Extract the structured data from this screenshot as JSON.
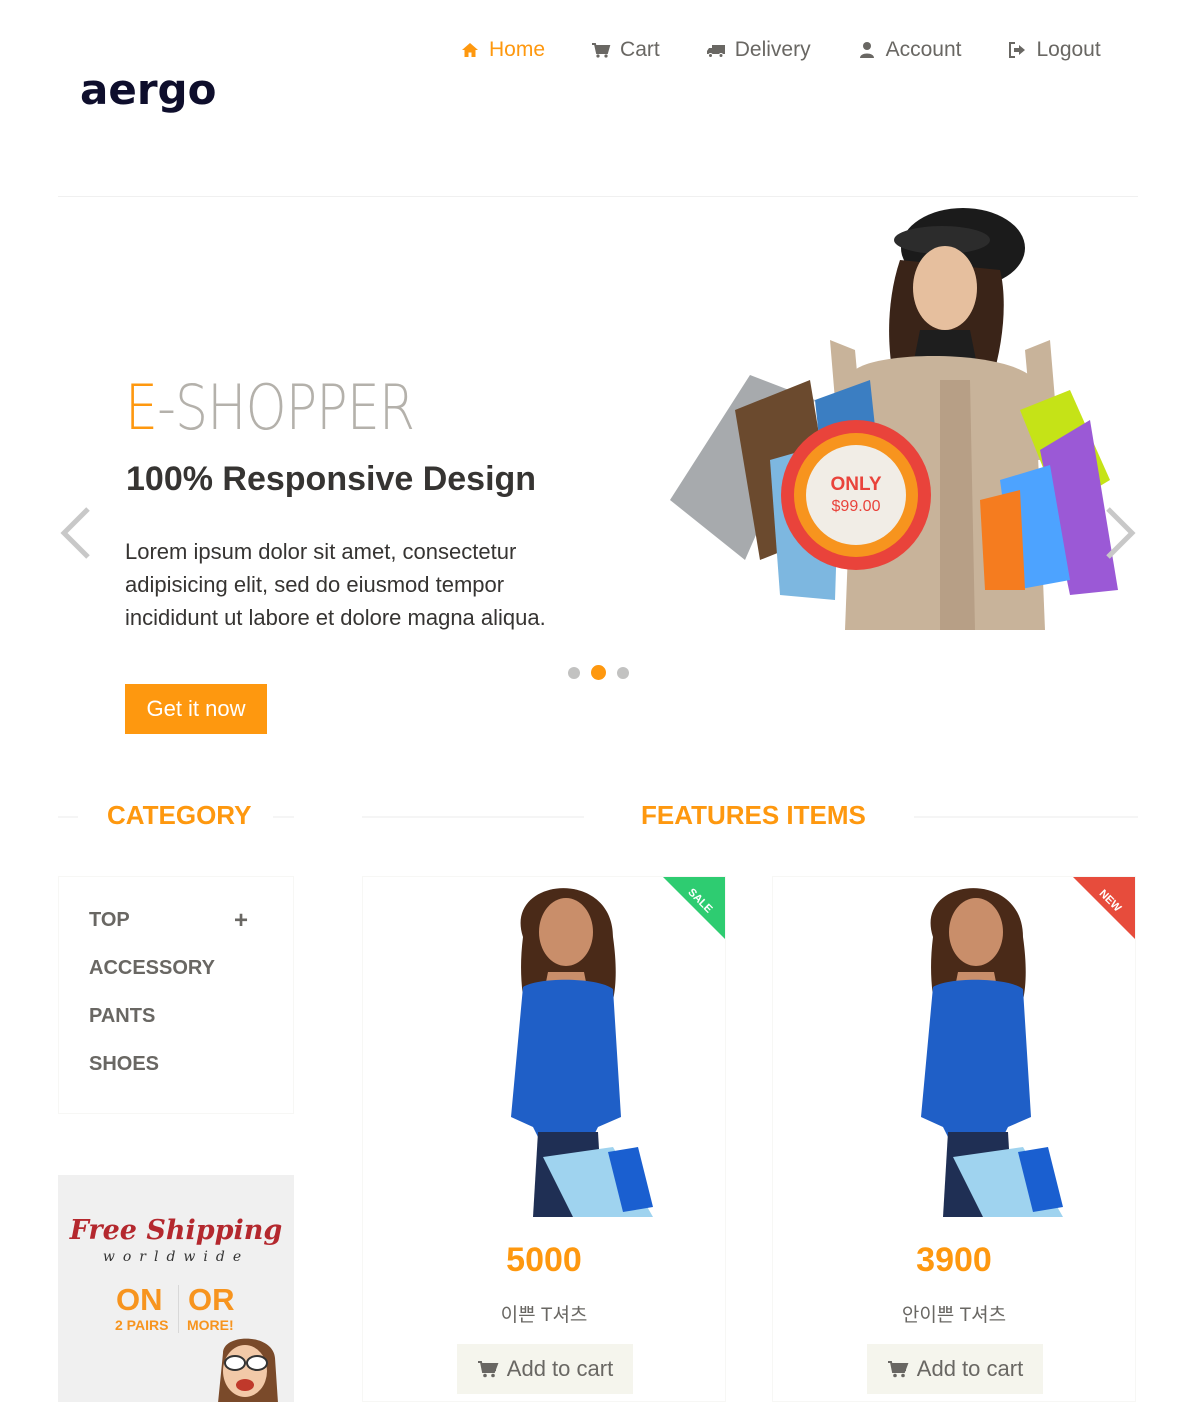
{
  "header": {
    "logo_text": "aergo",
    "nav": [
      {
        "label": "Home",
        "icon": "home-icon",
        "active": true
      },
      {
        "label": "Cart",
        "icon": "cart-icon",
        "active": false
      },
      {
        "label": "Delivery",
        "icon": "truck-icon",
        "active": false
      },
      {
        "label": "Account",
        "icon": "user-icon",
        "active": false
      },
      {
        "label": "Logout",
        "icon": "logout-icon",
        "active": false
      }
    ]
  },
  "slider": {
    "title_accent": "E",
    "title_rest": "-SHOPPER",
    "subtitle": "100% Responsive Design",
    "text": "Lorem ipsum dolor sit amet, consectetur adipisicing elit, sed do eiusmod tempor incididunt ut labore et dolore magna aliqua.",
    "button_label": "Get it now",
    "badge_label": "ONLY",
    "badge_price": "$99.00",
    "slides_total": 3,
    "active_slide": 2
  },
  "sections": {
    "category_title": "CATEGORY",
    "features_title": "FEATURES ITEMS"
  },
  "categories": [
    {
      "label": "TOP",
      "expandable": true,
      "toggle": "+"
    },
    {
      "label": "ACCESSORY"
    },
    {
      "label": "PANTS"
    },
    {
      "label": "SHOES"
    }
  ],
  "shipping_ad": {
    "title": "Free Shipping",
    "subtitle": "worldwide",
    "left_big": "ON",
    "left_small": "2 PAIRS",
    "right_big": "OR",
    "right_small": "MORE!"
  },
  "products": [
    {
      "price": "5000",
      "name": "이쁜 T셔츠",
      "ribbon": "SALE",
      "ribbon_color": "#2ecc71",
      "button_label": "Add to cart"
    },
    {
      "price": "3900",
      "name": "안이쁜 T셔츠",
      "ribbon": "NEW",
      "ribbon_color": "#e74c3c",
      "button_label": "Add to cart"
    }
  ],
  "colors": {
    "accent": "#FE980F",
    "text": "#696763",
    "dark_text": "#363432",
    "button_bg": "#F5F5ED"
  }
}
